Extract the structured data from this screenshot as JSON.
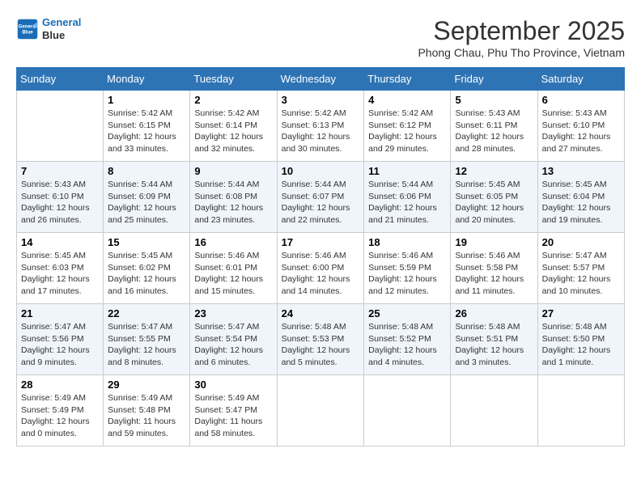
{
  "header": {
    "logo_line1": "General",
    "logo_line2": "Blue",
    "month": "September 2025",
    "location": "Phong Chau, Phu Tho Province, Vietnam"
  },
  "days_of_week": [
    "Sunday",
    "Monday",
    "Tuesday",
    "Wednesday",
    "Thursday",
    "Friday",
    "Saturday"
  ],
  "weeks": [
    [
      {
        "day": "",
        "text": ""
      },
      {
        "day": "1",
        "text": "Sunrise: 5:42 AM\nSunset: 6:15 PM\nDaylight: 12 hours\nand 33 minutes."
      },
      {
        "day": "2",
        "text": "Sunrise: 5:42 AM\nSunset: 6:14 PM\nDaylight: 12 hours\nand 32 minutes."
      },
      {
        "day": "3",
        "text": "Sunrise: 5:42 AM\nSunset: 6:13 PM\nDaylight: 12 hours\nand 30 minutes."
      },
      {
        "day": "4",
        "text": "Sunrise: 5:42 AM\nSunset: 6:12 PM\nDaylight: 12 hours\nand 29 minutes."
      },
      {
        "day": "5",
        "text": "Sunrise: 5:43 AM\nSunset: 6:11 PM\nDaylight: 12 hours\nand 28 minutes."
      },
      {
        "day": "6",
        "text": "Sunrise: 5:43 AM\nSunset: 6:10 PM\nDaylight: 12 hours\nand 27 minutes."
      }
    ],
    [
      {
        "day": "7",
        "text": "Sunrise: 5:43 AM\nSunset: 6:10 PM\nDaylight: 12 hours\nand 26 minutes."
      },
      {
        "day": "8",
        "text": "Sunrise: 5:44 AM\nSunset: 6:09 PM\nDaylight: 12 hours\nand 25 minutes."
      },
      {
        "day": "9",
        "text": "Sunrise: 5:44 AM\nSunset: 6:08 PM\nDaylight: 12 hours\nand 23 minutes."
      },
      {
        "day": "10",
        "text": "Sunrise: 5:44 AM\nSunset: 6:07 PM\nDaylight: 12 hours\nand 22 minutes."
      },
      {
        "day": "11",
        "text": "Sunrise: 5:44 AM\nSunset: 6:06 PM\nDaylight: 12 hours\nand 21 minutes."
      },
      {
        "day": "12",
        "text": "Sunrise: 5:45 AM\nSunset: 6:05 PM\nDaylight: 12 hours\nand 20 minutes."
      },
      {
        "day": "13",
        "text": "Sunrise: 5:45 AM\nSunset: 6:04 PM\nDaylight: 12 hours\nand 19 minutes."
      }
    ],
    [
      {
        "day": "14",
        "text": "Sunrise: 5:45 AM\nSunset: 6:03 PM\nDaylight: 12 hours\nand 17 minutes."
      },
      {
        "day": "15",
        "text": "Sunrise: 5:45 AM\nSunset: 6:02 PM\nDaylight: 12 hours\nand 16 minutes."
      },
      {
        "day": "16",
        "text": "Sunrise: 5:46 AM\nSunset: 6:01 PM\nDaylight: 12 hours\nand 15 minutes."
      },
      {
        "day": "17",
        "text": "Sunrise: 5:46 AM\nSunset: 6:00 PM\nDaylight: 12 hours\nand 14 minutes."
      },
      {
        "day": "18",
        "text": "Sunrise: 5:46 AM\nSunset: 5:59 PM\nDaylight: 12 hours\nand 12 minutes."
      },
      {
        "day": "19",
        "text": "Sunrise: 5:46 AM\nSunset: 5:58 PM\nDaylight: 12 hours\nand 11 minutes."
      },
      {
        "day": "20",
        "text": "Sunrise: 5:47 AM\nSunset: 5:57 PM\nDaylight: 12 hours\nand 10 minutes."
      }
    ],
    [
      {
        "day": "21",
        "text": "Sunrise: 5:47 AM\nSunset: 5:56 PM\nDaylight: 12 hours\nand 9 minutes."
      },
      {
        "day": "22",
        "text": "Sunrise: 5:47 AM\nSunset: 5:55 PM\nDaylight: 12 hours\nand 8 minutes."
      },
      {
        "day": "23",
        "text": "Sunrise: 5:47 AM\nSunset: 5:54 PM\nDaylight: 12 hours\nand 6 minutes."
      },
      {
        "day": "24",
        "text": "Sunrise: 5:48 AM\nSunset: 5:53 PM\nDaylight: 12 hours\nand 5 minutes."
      },
      {
        "day": "25",
        "text": "Sunrise: 5:48 AM\nSunset: 5:52 PM\nDaylight: 12 hours\nand 4 minutes."
      },
      {
        "day": "26",
        "text": "Sunrise: 5:48 AM\nSunset: 5:51 PM\nDaylight: 12 hours\nand 3 minutes."
      },
      {
        "day": "27",
        "text": "Sunrise: 5:48 AM\nSunset: 5:50 PM\nDaylight: 12 hours\nand 1 minute."
      }
    ],
    [
      {
        "day": "28",
        "text": "Sunrise: 5:49 AM\nSunset: 5:49 PM\nDaylight: 12 hours\nand 0 minutes."
      },
      {
        "day": "29",
        "text": "Sunrise: 5:49 AM\nSunset: 5:48 PM\nDaylight: 11 hours\nand 59 minutes."
      },
      {
        "day": "30",
        "text": "Sunrise: 5:49 AM\nSunset: 5:47 PM\nDaylight: 11 hours\nand 58 minutes."
      },
      {
        "day": "",
        "text": ""
      },
      {
        "day": "",
        "text": ""
      },
      {
        "day": "",
        "text": ""
      },
      {
        "day": "",
        "text": ""
      }
    ]
  ]
}
